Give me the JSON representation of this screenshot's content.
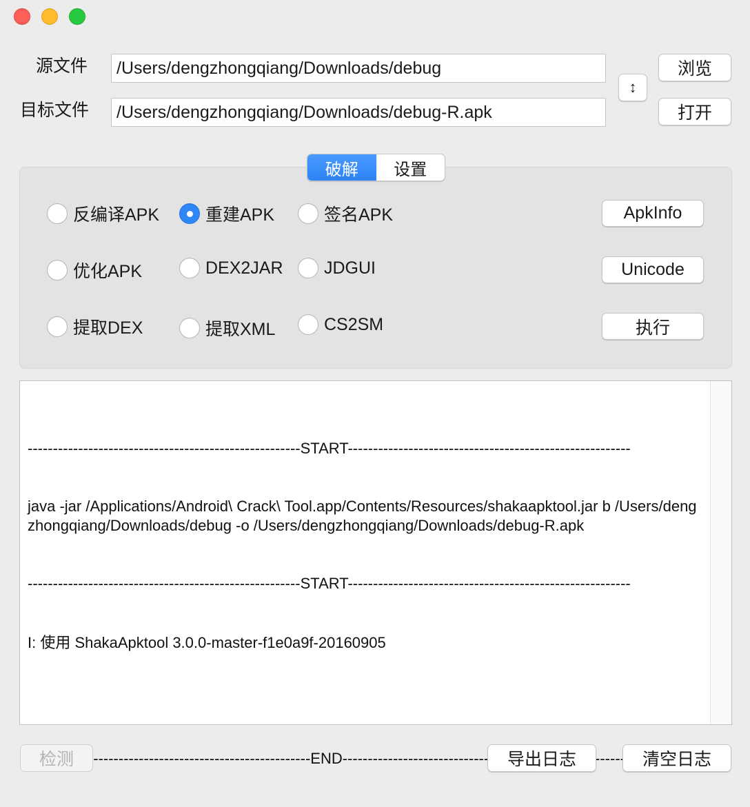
{
  "window": {
    "controls": [
      "close",
      "minimize",
      "maximize"
    ]
  },
  "files": {
    "source_label": "源文件",
    "source_value": "/Users/dengzhongqiang/Downloads/debug",
    "target_label": "目标文件",
    "target_value": "/Users/dengzhongqiang/Downloads/debug-R.apk",
    "browse_button": "浏览",
    "open_button": "打开",
    "swap_icon": "↕"
  },
  "tabs": [
    {
      "label": "破解",
      "active": true
    },
    {
      "label": "设置",
      "active": false
    }
  ],
  "options": {
    "row1": [
      "反编译APK",
      "重建APK",
      "签名APK"
    ],
    "row2": [
      "优化APK",
      "DEX2JAR",
      "JDGUI"
    ],
    "row3": [
      "提取DEX",
      "提取XML",
      "CS2SM"
    ],
    "selected": "重建APK"
  },
  "side_buttons": {
    "apkinfo": "ApkInfo",
    "unicode": "Unicode",
    "execute": "执行"
  },
  "log": {
    "lines": [
      "------------------------------------------------------START--------------------------------------------------------",
      "java -jar /Applications/Android\\ Crack\\ Tool.app/Contents/Resources/shakaapktool.jar b /Users/dengzhongqiang/Downloads/debug -o /Users/dengzhongqiang/Downloads/debug-R.apk",
      "------------------------------------------------------START--------------------------------------------------------",
      "I: 使用 ShakaApktool 3.0.0-master-f1e0a9f-20160905",
      "",
      "--------------------------------------------------------END--------------------------------------------------------"
    ]
  },
  "bottom": {
    "detect_button": "检测",
    "export_button": "导出日志",
    "clear_button": "清空日志"
  },
  "colors": {
    "accent": "#2f86f6",
    "close": "#fe5f57",
    "minimize": "#febc2e",
    "maximize": "#28c840"
  }
}
